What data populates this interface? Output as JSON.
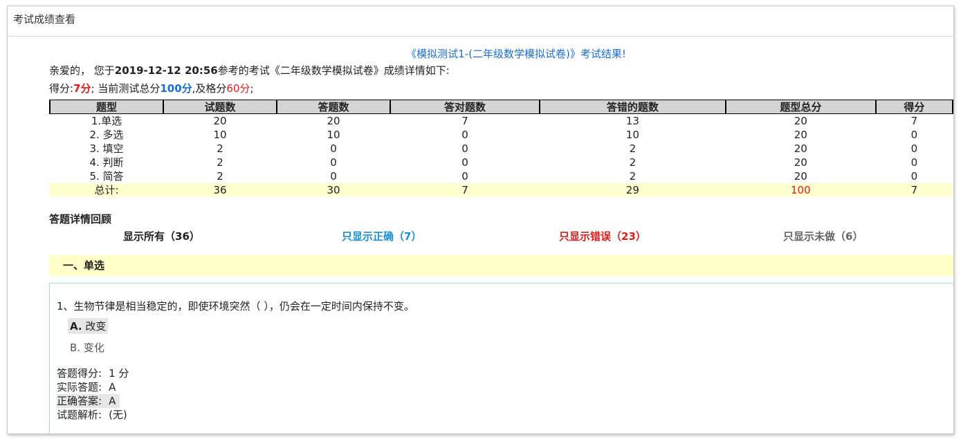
{
  "window": {
    "title": "考试成绩查看"
  },
  "result": {
    "title": "《模拟测试1-(二年级数学模拟试卷)》考试结果!",
    "intro_prefix": "亲爱的，  您于",
    "datetime": "2019-12-12 20:56",
    "intro_mid": "参考的考试《二年级数学模拟试卷》成绩详情如下:",
    "score_label": "得分:",
    "score_value": "7分",
    "score_sep": ";  当前测试总分",
    "total_value": "100分",
    "pass_label": ",及格分",
    "pass_value": "60分",
    "end_punct": ";"
  },
  "stats": {
    "headers": [
      "题型",
      "试题数",
      "答题数",
      "答对题数",
      "答错的题数",
      "题型总分",
      "得分"
    ],
    "rows": [
      [
        "1.单选",
        "20",
        "20",
        "7",
        "13",
        "20",
        "7"
      ],
      [
        "2. 多选",
        "10",
        "10",
        "0",
        "10",
        "20",
        "0"
      ],
      [
        "3. 填空",
        "2",
        "0",
        "0",
        "2",
        "20",
        "0"
      ],
      [
        "4. 判断",
        "2",
        "0",
        "0",
        "2",
        "20",
        "0"
      ],
      [
        "5. 简答",
        "2",
        "0",
        "0",
        "2",
        "20",
        "0"
      ]
    ],
    "total": [
      "总计:",
      "36",
      "30",
      "7",
      "29",
      "100",
      "7"
    ]
  },
  "review": {
    "title": "答题详情回顾",
    "filters": {
      "all": "显示所有（36）",
      "correct": "只显示正确（7）",
      "wrong": "只显示错误（23）",
      "undone": "只显示未做（6）"
    },
    "section": "一、单选"
  },
  "question": {
    "text": "1、生物节律是相当稳定的，即使环境突然（ ），仍会在一定时间内保持不变。",
    "option_a_label": "A.",
    "option_a_text": " 改变",
    "option_b": "B. 变化",
    "score_label": "答题得分:",
    "score_value": "1 分",
    "actual_label": "实际答题:",
    "actual_value": "A",
    "correct_label": "正确答案:",
    "correct_value": "A",
    "analysis_label": "试题解析:",
    "analysis_value": "(无)"
  },
  "colors": {
    "accent_blue": "#1a6fd6",
    "accent_red": "#e01b1b",
    "highlight_yellow": "#ffffd0",
    "header_gray": "#d4d4d4"
  }
}
